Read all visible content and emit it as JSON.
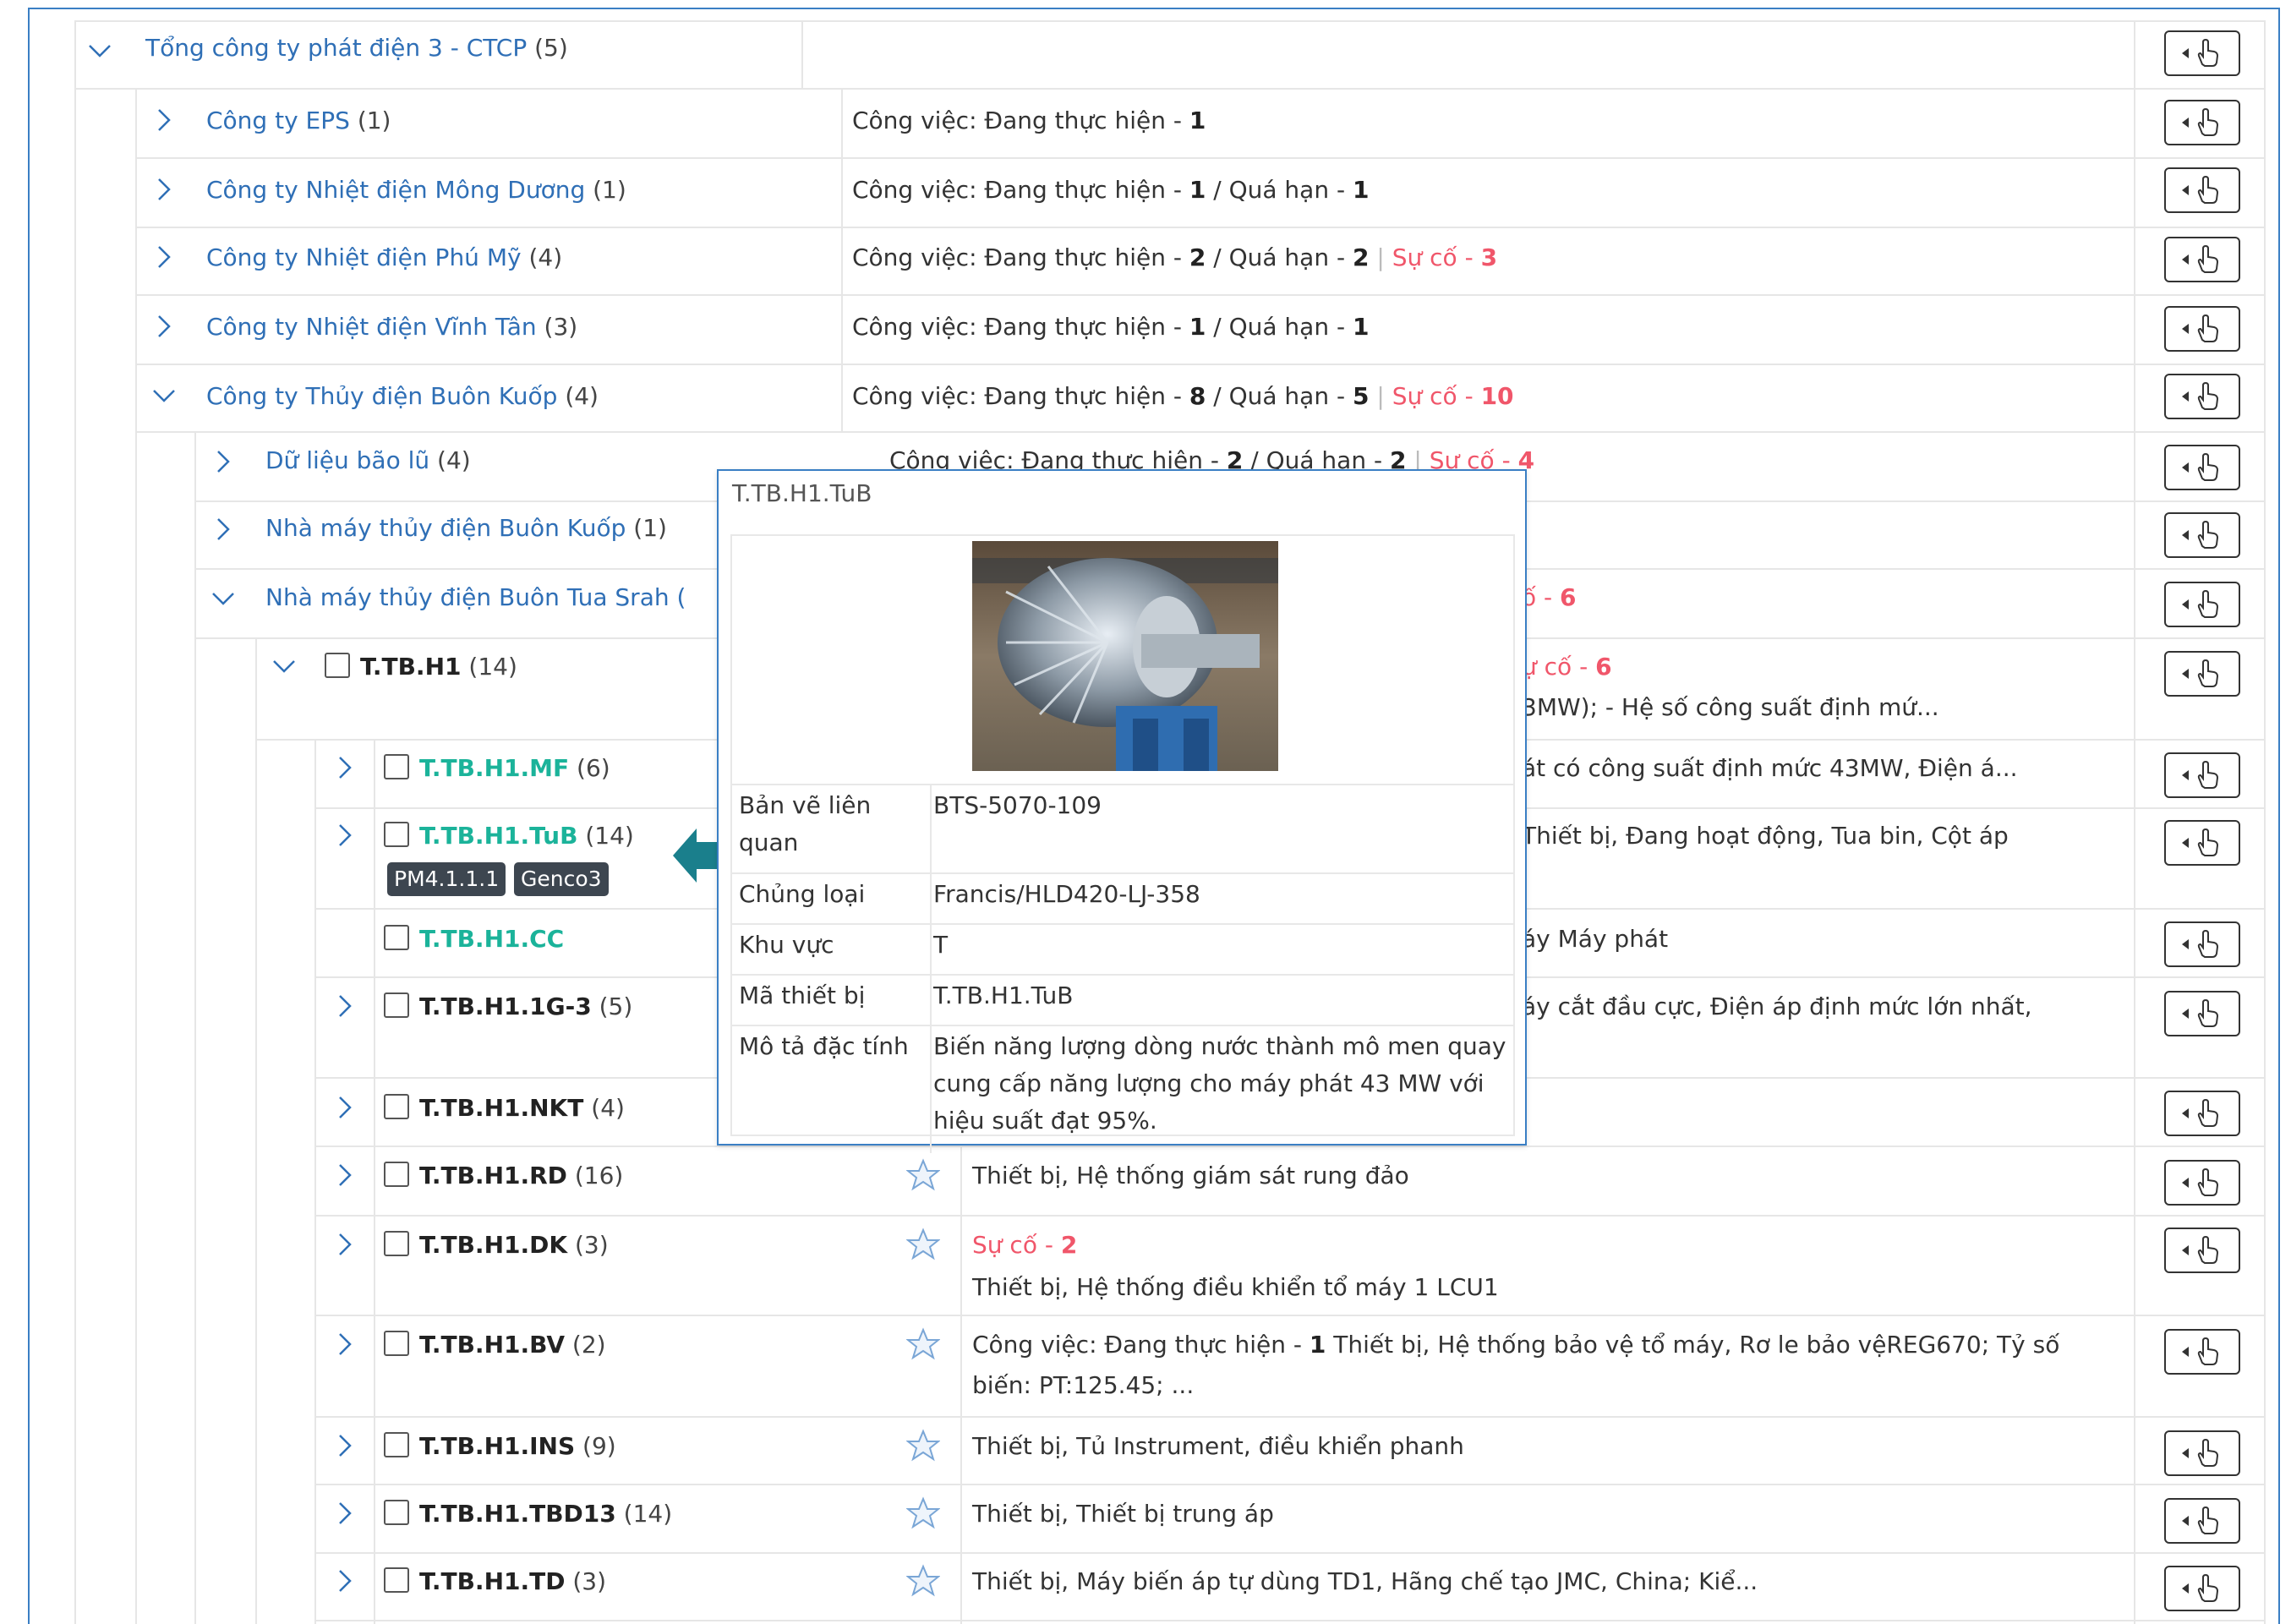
{
  "root": {
    "name": "Tổng công ty phát điện 3 - CTCP",
    "count": "(5)"
  },
  "companies": [
    {
      "name": "Công ty EPS",
      "count": "(1)",
      "d1": "Công việc: Đang thực hiện - ",
      "v1": "1",
      "d2": "",
      "v2": "",
      "d3": "",
      "v3": ""
    },
    {
      "name": "Công ty Nhiệt điện Mông Dương",
      "count": "(1)",
      "d1": "Công việc: Đang thực hiện - ",
      "v1": "1",
      "d2": " / Quá hạn - ",
      "v2": "1",
      "d3": "",
      "v3": ""
    },
    {
      "name": "Công ty Nhiệt điện Phú Mỹ",
      "count": "(4)",
      "d1": "Công việc: Đang thực hiện - ",
      "v1": "2",
      "d2": " / Quá hạn - ",
      "v2": "2",
      "d3": "Sự cố - ",
      "v3": "3"
    },
    {
      "name": "Công ty Nhiệt điện Vĩnh Tân",
      "count": "(3)",
      "d1": "Công việc: Đang thực hiện - ",
      "v1": "1",
      "d2": " / Quá hạn - ",
      "v2": "1",
      "d3": "",
      "v3": ""
    },
    {
      "name": "Công ty Thủy điện Buôn Kuốp",
      "count": "(4)",
      "d1": "Công việc: Đang thực hiện - ",
      "v1": "8",
      "d2": " / Quá hạn - ",
      "v2": "5",
      "d3": "Sự cố - ",
      "v3": "10"
    }
  ],
  "sub": [
    {
      "name": "Dữ liệu bão lũ",
      "count": "(4)",
      "desc": "Công việc: Đang thực hiện - ",
      "v1": "2",
      "d2": " / Quá hạn - ",
      "v2": "2",
      "d3": "Sự cố - ",
      "v3": "4"
    },
    {
      "name": "Nhà máy thủy điện Buôn Kuốp",
      "count": "(1)"
    },
    {
      "name": "Nhà máy thủy điện Buôn Tua Srah (",
      "count": "",
      "tail": "ố - ",
      "tailv": "6"
    }
  ],
  "unit": {
    "code": "T.TB.H1",
    "count": "(14)",
    "red": "ự cố - ",
    "redv": "6",
    "desc2": "3MW); - Hệ số công suất định mứ..."
  },
  "devices": [
    {
      "code": "T.TB.H1.MF",
      "count": "(6)",
      "desc": "át có công suất định mức 43MW, Điện á..."
    },
    {
      "code": "T.TB.H1.TuB",
      "count": "(14)",
      "desc": "Thiết bị, Đang hoạt động, Tua bin, Cột áp"
    },
    {
      "code": "T.TB.H1.CC",
      "count": "",
      "desc": "áy Máy phát"
    },
    {
      "code": "T.TB.H1.1G-3",
      "count": "(5)",
      "desc": "áy cắt đầu cực, Điện áp định mức lớn nhất,"
    },
    {
      "code": "T.TB.H1.NKT",
      "count": "(4)",
      "desc": ""
    },
    {
      "code": "T.TB.H1.RD",
      "count": "(16)",
      "desc": "Thiết bị, Hệ thống giám sát rung đảo"
    },
    {
      "code": "T.TB.H1.DK",
      "count": "(3)",
      "red": "Sự cố - ",
      "redv": "2",
      "desc": "Thiết bị, Hệ thống điều khiển tổ máy 1 LCU1"
    },
    {
      "code": "T.TB.H1.BV",
      "count": "(2)",
      "pre": "Công việc: Đang thực hiện - ",
      "prev": "1",
      "desc": " Thiết bị, Hệ thống bảo vệ tổ máy, Rơ le bảo vệREG670; Tỷ số",
      "desc2": "biến: PT:125.45; ..."
    },
    {
      "code": "T.TB.H1.INS",
      "count": "(9)",
      "desc": "Thiết bị, Tủ Instrument, điều khiển phanh"
    },
    {
      "code": "T.TB.H1.TBD13",
      "count": "(14)",
      "desc": "Thiết bị, Thiết bị trung áp"
    },
    {
      "code": "T.TB.H1.TD",
      "count": "(3)",
      "desc": "Thiết bị, Máy biến áp tự dùng TD1, Hãng chế tạo JMC, China; Kiể..."
    }
  ],
  "tags": [
    "PM4.1.1.1",
    "Genco3"
  ],
  "popup": {
    "title": "T.TB.H1.TuB",
    "rows": [
      {
        "label": "Bản vẽ liên quan",
        "value": "BTS-5070-109"
      },
      {
        "label": "Chủng loại",
        "value": "Francis/HLD420-LJ-358"
      },
      {
        "label": "Khu vực",
        "value": "T"
      },
      {
        "label": "Mã thiết bị",
        "value": "T.TB.H1.TuB"
      },
      {
        "label": "Mô tả đặc tính",
        "value": "Biến năng lượng dòng nước thành mô men quay cung cấp năng lượng cho máy phát 43 MW với hiệu suất đạt 95%."
      }
    ]
  },
  "colors": {
    "link": "#2f6fb6",
    "teal": "#1bb39a",
    "red": "#f0566a",
    "border": "#3a7fc4",
    "tag": "#3d4650",
    "arrow": "#1a7f8c"
  },
  "icons": {
    "expand": "chevron-right-icon",
    "collapse": "chevron-down-icon",
    "action": "hand-pointer-icon",
    "favorite": "star-icon"
  }
}
